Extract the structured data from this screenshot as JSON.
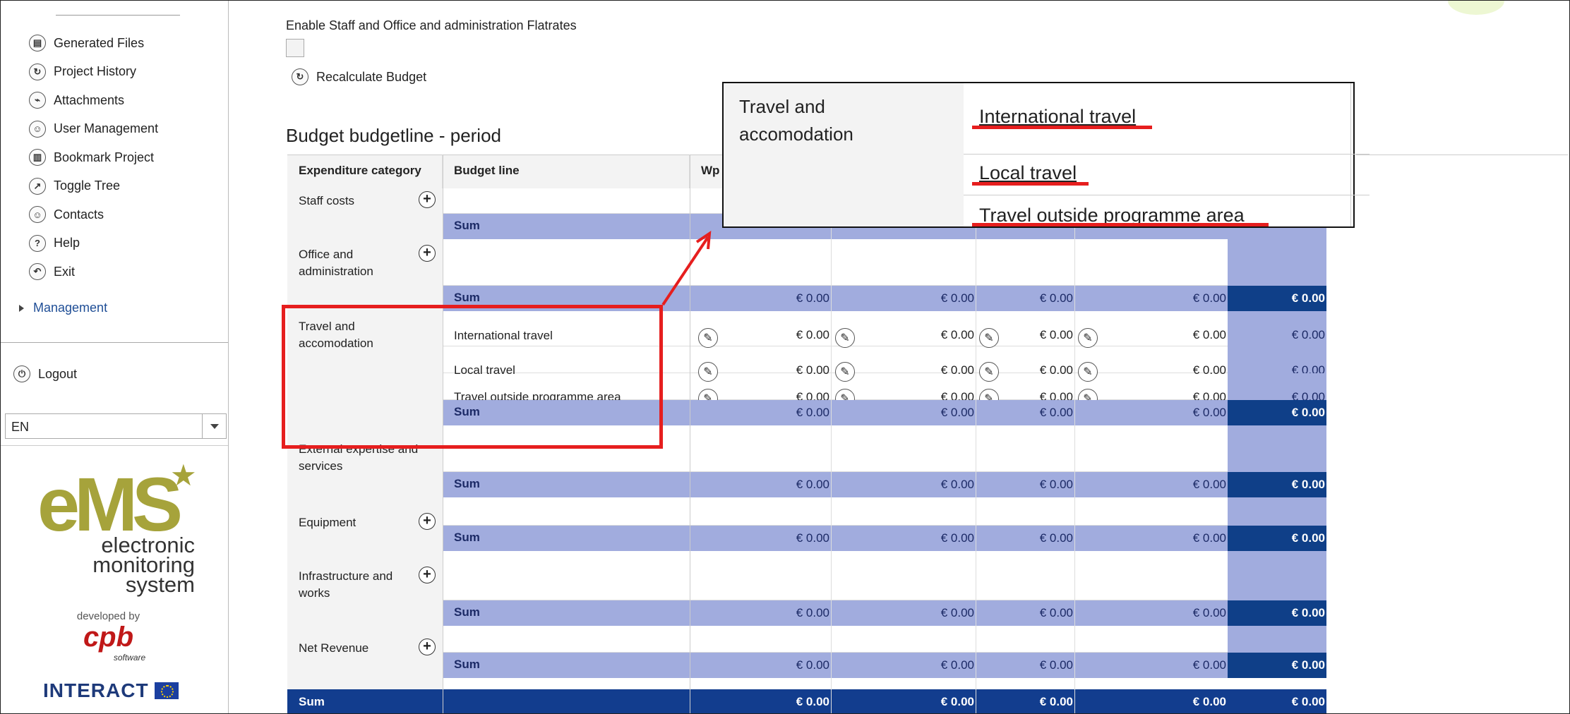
{
  "sidebar": {
    "items": [
      {
        "label": "Generated Files",
        "icon": "floppy-icon",
        "glyph": "▤"
      },
      {
        "label": "Project History",
        "icon": "history-icon",
        "glyph": "↻"
      },
      {
        "label": "Attachments",
        "icon": "paperclip-icon",
        "glyph": "⌁"
      },
      {
        "label": "User Management",
        "icon": "user-icon",
        "glyph": "☺"
      },
      {
        "label": "Bookmark Project",
        "icon": "bookmark-icon",
        "glyph": "▥"
      },
      {
        "label": "Toggle Tree",
        "icon": "external-link-icon",
        "glyph": "↗"
      },
      {
        "label": "Contacts",
        "icon": "contact-icon",
        "glyph": "☺"
      },
      {
        "label": "Help",
        "icon": "help-icon",
        "glyph": "?"
      },
      {
        "label": "Exit",
        "icon": "exit-icon",
        "glyph": "↶"
      }
    ],
    "management": "Management",
    "logout": "Logout",
    "language": "EN",
    "logo": {
      "ems": "eMS",
      "subtitle_1": "electronic",
      "subtitle_2": "monitoring",
      "subtitle_3": "system",
      "developed_by": "developed by",
      "cpb": "cpb",
      "software": "software",
      "interact": "INTERACT"
    }
  },
  "main": {
    "enable_flatrates": "Enable Staff and Office and administration Flatrates",
    "recalculate": "Recalculate Budget",
    "title": "Budget budgetline - period",
    "columns": [
      "Expenditure category",
      "Budget line",
      "Wp"
    ],
    "sum_label": "Sum",
    "zero": "€ 0.00",
    "categories": {
      "staff": "Staff costs",
      "office_1": "Office and",
      "office_2": "administration",
      "travel_1": "Travel and",
      "travel_2": "accomodation",
      "external_1": "External expertise and",
      "external_2": "services",
      "equipment": "Equipment",
      "infra_1": "Infrastructure and",
      "infra_2": "works",
      "revenue": "Net Revenue"
    },
    "travel_lines": [
      "International travel",
      "Local travel",
      "Travel outside programme area"
    ]
  },
  "callout": {
    "category_1": "Travel and",
    "category_2": "accomodation",
    "links": [
      "International travel",
      "Local travel",
      "Travel outside programme area"
    ]
  },
  "colors": {
    "accent_red": "#e61e1e",
    "sum_row": "#a1acde",
    "dark_blue": "#0f3f88"
  }
}
